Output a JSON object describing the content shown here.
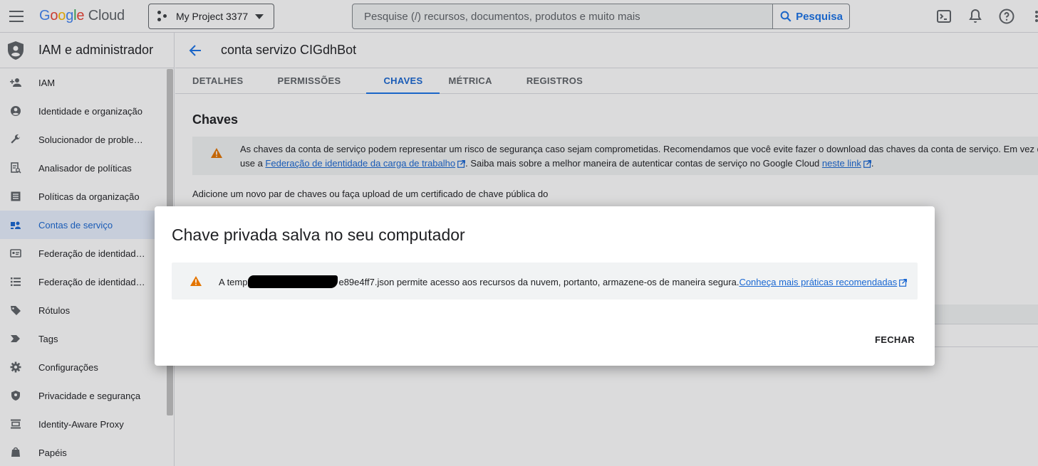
{
  "header": {
    "logo_parts": [
      "G",
      "o",
      "o",
      "g",
      "l",
      "e"
    ],
    "logo_cloud": "Cloud",
    "project": "My Project 3377",
    "search_placeholder": "Pesquise (/) recursos, documentos, produtos e muito mais",
    "search_button": "Pesquisa"
  },
  "sidebar": {
    "title": "IAM e administrador",
    "items": [
      {
        "label": "IAM",
        "icon": "person-add-icon"
      },
      {
        "label": "Identidade e organização",
        "icon": "account-circle-icon"
      },
      {
        "label": "Solucionador de problem...",
        "icon": "wrench-icon"
      },
      {
        "label": "Analisador de políticas",
        "icon": "policy-analyzer-icon"
      },
      {
        "label": "Políticas da organização",
        "icon": "list-alt-icon"
      },
      {
        "label": "Contas de serviço",
        "icon": "service-account-icon"
      },
      {
        "label": "Federação de identidade ...",
        "icon": "id-card-icon"
      },
      {
        "label": "Federação de identidade ...",
        "icon": "list-icon"
      },
      {
        "label": "Rótulos",
        "icon": "label-icon"
      },
      {
        "label": "Tags",
        "icon": "tag-icon"
      },
      {
        "label": "Configurações",
        "icon": "gear-icon"
      },
      {
        "label": "Privacidade e segurança",
        "icon": "shield-icon"
      },
      {
        "label": "Identity-Aware Proxy",
        "icon": "proxy-icon"
      },
      {
        "label": "Papéis",
        "icon": "roles-icon"
      }
    ]
  },
  "main": {
    "title": "conta servizo CIGdhBot",
    "tabs": [
      "DETALHES",
      "PERMISSÕES",
      "CHAVES",
      "MÉTRICA",
      "REGISTROS"
    ],
    "section_title": "Chaves",
    "warning_line1": "As chaves da conta de serviço podem representar um risco de segurança caso sejam comprometidas. Recomendamos que você evite fazer o download das chaves da conta de serviço. Em vez d",
    "warning_line2_pre": "use a ",
    "warning_link1": "Federação de identidade da carga de trabalho",
    "warning_line2_mid": ". Saiba mais sobre a melhor maneira de autenticar contas de serviço no Google Cloud ",
    "warning_link2": "neste link",
    "warning_line2_end": ".",
    "add_text": "Adicione um novo par de chaves ou faça upload de um certificado de chave pública do"
  },
  "dialog": {
    "title": "Chave privada salva no seu computador",
    "msg_pre": "A temp",
    "msg_post": "e89e4ff7.json permite acesso aos recursos da nuvem, portanto, armazene-os de maneira segura.",
    "link": "Conheça mais práticas recomendadas",
    "close": "FECHAR"
  },
  "colors": {
    "accent": "#1a73e8",
    "warning": "#e37400",
    "active_bg": "#e8f0fe"
  }
}
